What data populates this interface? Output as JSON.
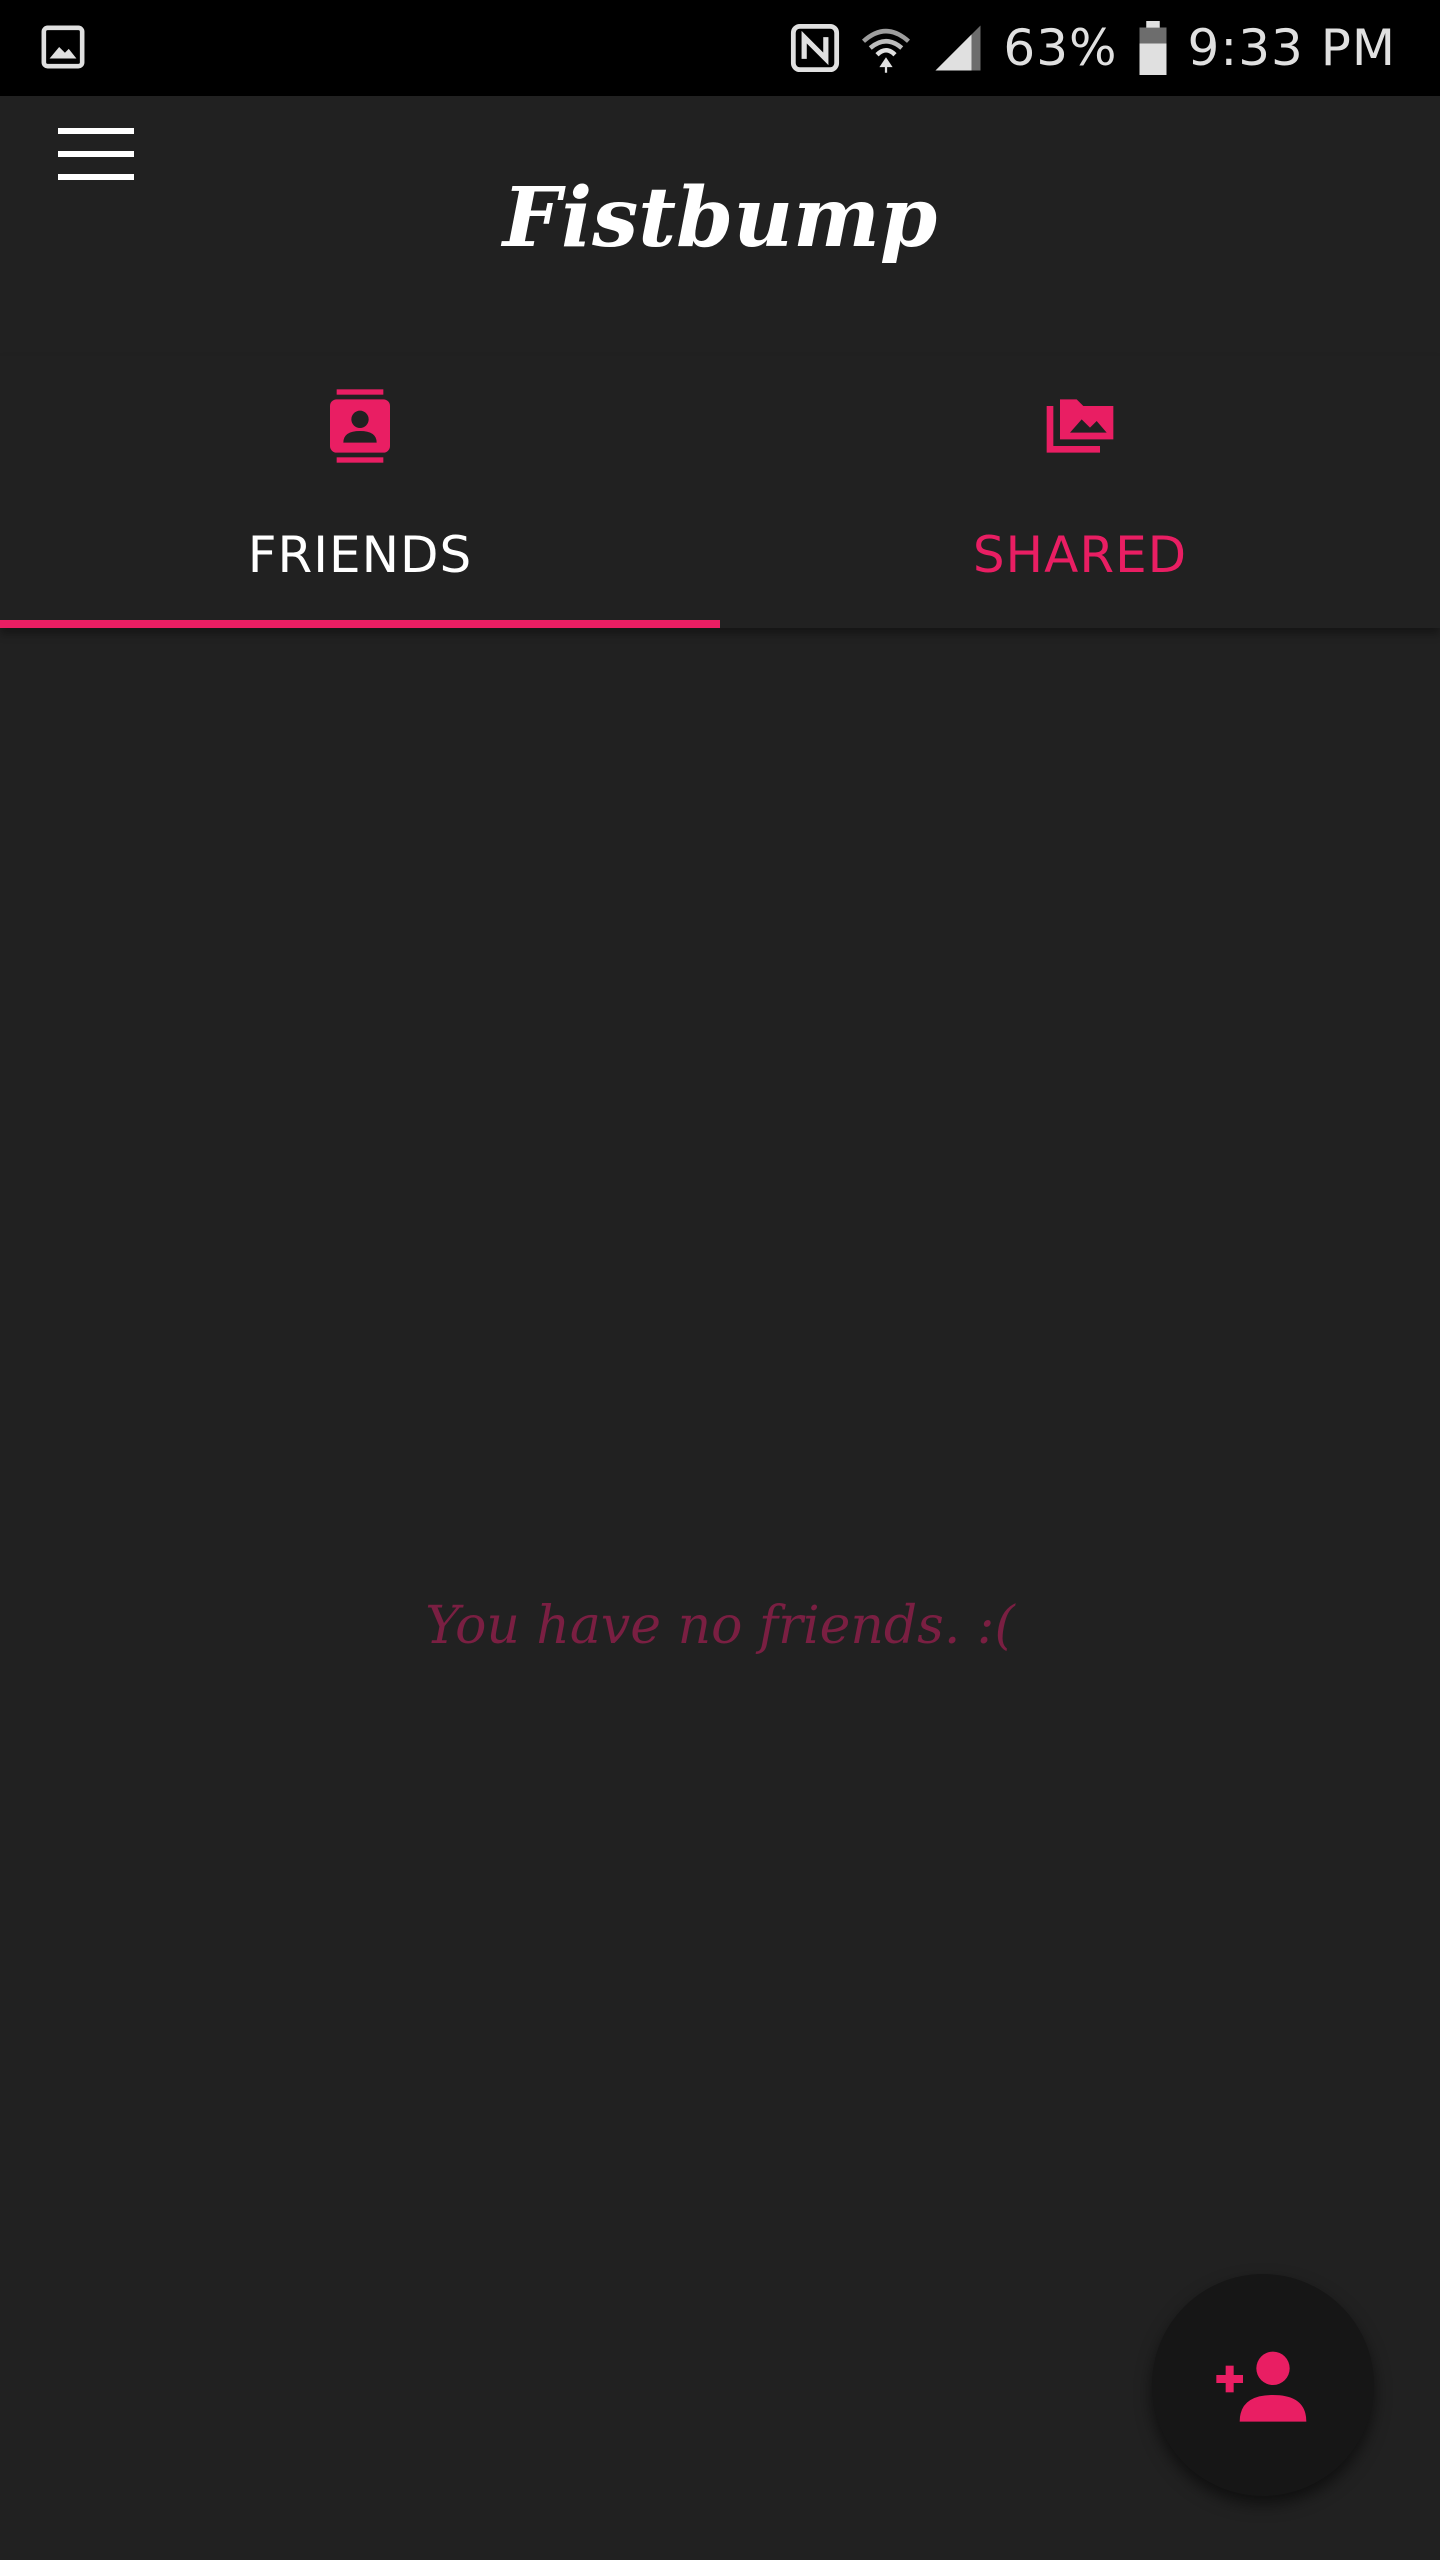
{
  "status_bar": {
    "battery": "63%",
    "time": "9:33 PM",
    "icons": [
      "image-notification-icon",
      "nfc-icon",
      "wifi-icon",
      "signal-icon",
      "battery-icon"
    ]
  },
  "app_bar": {
    "title": "Fistbump",
    "menu_icon": "hamburger-menu-icon"
  },
  "tabs": [
    {
      "label": "FRIENDS",
      "icon": "contacts-icon",
      "active": true
    },
    {
      "label": "SHARED",
      "icon": "photo-library-icon",
      "active": false
    }
  ],
  "main": {
    "empty_message": "You have no friends. :("
  },
  "fab": {
    "icon": "add-person-icon"
  },
  "colors": {
    "accent": "#e91e63",
    "background": "#212121",
    "status_bar": "#000000",
    "empty_text": "#7a1f42"
  }
}
